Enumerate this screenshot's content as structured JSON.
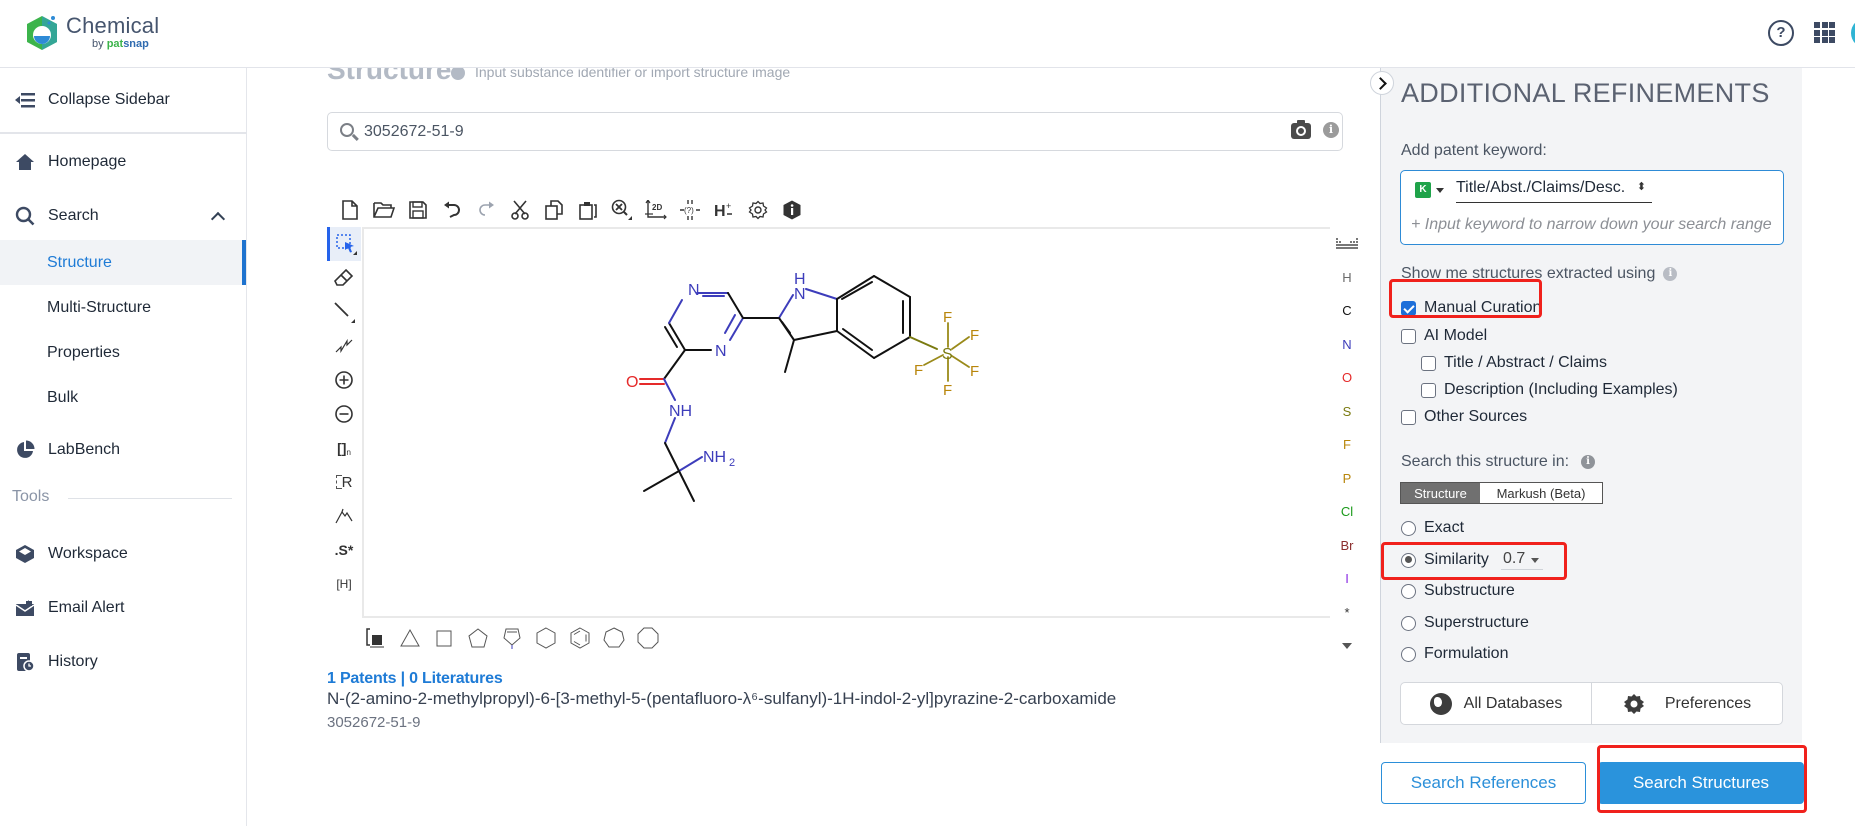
{
  "header": {
    "brand_name": "Chemical",
    "brand_by": "by",
    "brand_pat": "pat",
    "brand_snap": "snap",
    "help_icon": "question-circle-icon",
    "apps_icon": "grid-apps-icon"
  },
  "sidebar": {
    "collapse_label": "Collapse Sidebar",
    "items": [
      {
        "label": "Homepage",
        "icon": "home-icon"
      },
      {
        "label": "Search",
        "icon": "search-icon",
        "expanded": true
      },
      {
        "label": "LabBench",
        "icon": "pie-chart-icon"
      }
    ],
    "search_subitems": [
      {
        "label": "Structure",
        "active": true
      },
      {
        "label": "Multi-Structure",
        "active": false
      },
      {
        "label": "Properties",
        "active": false
      },
      {
        "label": "Bulk",
        "active": false
      }
    ],
    "tools_heading": "Tools",
    "tools": [
      {
        "label": "Workspace",
        "icon": "cube-icon"
      },
      {
        "label": "Email Alert",
        "icon": "email-alert-icon"
      },
      {
        "label": "History",
        "icon": "history-icon"
      }
    ]
  },
  "main": {
    "section_title": "Structure",
    "section_hint": "Input substance identifier or import structure image",
    "search_value": "3052672-51-9",
    "top_toolbar": [
      "new-file",
      "open",
      "save",
      "undo",
      "redo",
      "cut",
      "copy",
      "paste",
      "zoom",
      "2d-layout",
      "check-structure",
      "explicit-hydrogens",
      "settings",
      "about"
    ],
    "left_toolbar": [
      "select",
      "erase",
      "bond",
      "chain",
      "charge-plus",
      "charge-minus",
      "sgroup",
      "r-group",
      "reaction-arrow",
      "stereo-label",
      "hydrogen-bracket"
    ],
    "left_toolbar_text": {
      "sgroup": "[]",
      "sgroup_sub": "n",
      "rgroup": "R",
      "stereo": ".S*",
      "hbracket": "[H]"
    },
    "elements": [
      {
        "symbol": "H",
        "color": "#6b6b6b"
      },
      {
        "symbol": "C",
        "color": "#111111"
      },
      {
        "symbol": "N",
        "color": "#3d3dbb"
      },
      {
        "symbol": "O",
        "color": "#e52a2a"
      },
      {
        "symbol": "S",
        "color": "#7a7a10"
      },
      {
        "symbol": "F",
        "color": "#b8860b"
      },
      {
        "symbol": "P",
        "color": "#b8860b"
      },
      {
        "symbol": "Cl",
        "color": "#1a9a1a"
      },
      {
        "symbol": "Br",
        "color": "#8b2d2d"
      },
      {
        "symbol": "I",
        "color": "#8a2be2"
      },
      {
        "symbol": "*",
        "color": "#333333"
      }
    ],
    "templates": [
      "benzene-template-picker",
      "cyclopropane",
      "cyclobutane",
      "cyclopentane",
      "pyrrole",
      "cyclohexane",
      "benzene",
      "cycloheptane",
      "cyclooctane"
    ],
    "molecule_labels": {
      "n_pyrazine_top": "N",
      "n_pyrazine_bottom": "N",
      "o_carbonyl": "O",
      "nh_amide": "NH",
      "nh2": "NH",
      "nh2_sub": "2",
      "nh_indole": "N",
      "h_indole": "H",
      "s": "S",
      "f": "F"
    },
    "result": {
      "counts": "1 Patents | 0 Literatures",
      "name": "N-(2-amino-2-methylpropyl)-6-[3-methyl-5-(pentafluoro-λ⁶-sulfanyl)-1H-indol-2-yl]pyrazine-2-carboxamide",
      "cas": "3052672-51-9"
    }
  },
  "refinements": {
    "title": "ADDITIONAL REFINEMENTS",
    "keyword_label": "Add patent keyword:",
    "keyword_field_badge": "K",
    "keyword_scope": "Title/Abst./Claims/Desc.",
    "keyword_placeholder": "+ Input keyword to narrow down your search range",
    "extracted_label": "Show me structures extracted using",
    "sources": [
      {
        "label": "Manual Curation",
        "checked": true,
        "indent": 0
      },
      {
        "label": "AI Model",
        "checked": false,
        "indent": 0
      },
      {
        "label": "Title / Abstract / Claims",
        "checked": false,
        "indent": 1
      },
      {
        "label": "Description (Including Examples)",
        "checked": false,
        "indent": 1
      },
      {
        "label": "Other Sources",
        "checked": false,
        "indent": 0
      }
    ],
    "search_in_label": "Search this structure in:",
    "search_in_tabs": [
      {
        "label": "Structure",
        "active": true
      },
      {
        "label": "Markush (Beta)",
        "active": false
      }
    ],
    "search_types": [
      {
        "label": "Exact",
        "selected": false
      },
      {
        "label": "Similarity",
        "selected": true
      },
      {
        "label": "Substructure",
        "selected": false
      },
      {
        "label": "Superstructure",
        "selected": false
      },
      {
        "label": "Formulation",
        "selected": false
      }
    ],
    "similarity_value": "0.7",
    "databases_button": "All Databases",
    "preferences_button": "Preferences"
  },
  "actions": {
    "search_references": "Search References",
    "search_structures": "Search Structures"
  },
  "highlight_color": "#f0211c",
  "accent_color": "#2a93dc"
}
